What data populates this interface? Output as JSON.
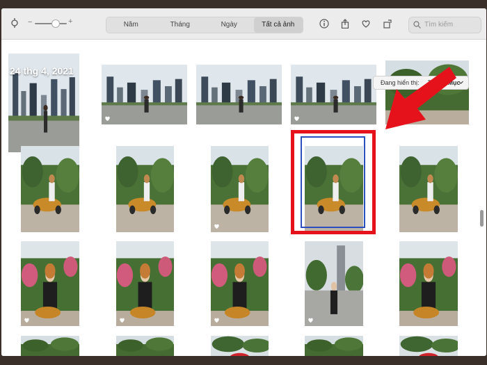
{
  "toolbar": {
    "tabs": [
      "Năm",
      "Tháng",
      "Ngày",
      "Tất cả ảnh"
    ],
    "active_tab": "Tất cả ảnh",
    "search_placeholder": "Tìm kiếm"
  },
  "header": {
    "date_title": "24 thg 4, 2021",
    "view_label": "Đang hiển thị:",
    "view_value": "Tất cả Mục"
  },
  "colors": {
    "highlight_red": "#e5121b",
    "selection_blue": "#2c4fbf",
    "toolbar_bg": "#ececec"
  },
  "icons": [
    "slider-icon",
    "info-icon",
    "share-icon",
    "heart-icon",
    "rotate-icon",
    "search-icon",
    "chevron-down-icon",
    "favorite-heart-icon",
    "arrow-annotation"
  ],
  "photos": [
    {
      "kind": "city",
      "heart": false
    },
    {
      "kind": "city",
      "heart": true
    },
    {
      "kind": "city",
      "heart": false
    },
    {
      "kind": "city",
      "heart": true
    },
    {
      "kind": "garden",
      "heart": false
    },
    {
      "kind": "vespa",
      "heart": false
    },
    {
      "kind": "vespa",
      "heart": false
    },
    {
      "kind": "vespa",
      "heart": true
    },
    {
      "kind": "vespa",
      "heart": false
    },
    {
      "kind": "vespa",
      "heart": false
    },
    {
      "kind": "girl",
      "heart": true
    },
    {
      "kind": "girl",
      "heart": true
    },
    {
      "kind": "girl",
      "heart": true
    },
    {
      "kind": "street",
      "heart": true
    },
    {
      "kind": "girl",
      "heart": false
    },
    {
      "kind": "garden",
      "heart": false
    },
    {
      "kind": "garden",
      "heart": false
    },
    {
      "kind": "sign",
      "heart": false
    },
    {
      "kind": "garden",
      "heart": false
    },
    {
      "kind": "sign",
      "heart": false
    }
  ]
}
